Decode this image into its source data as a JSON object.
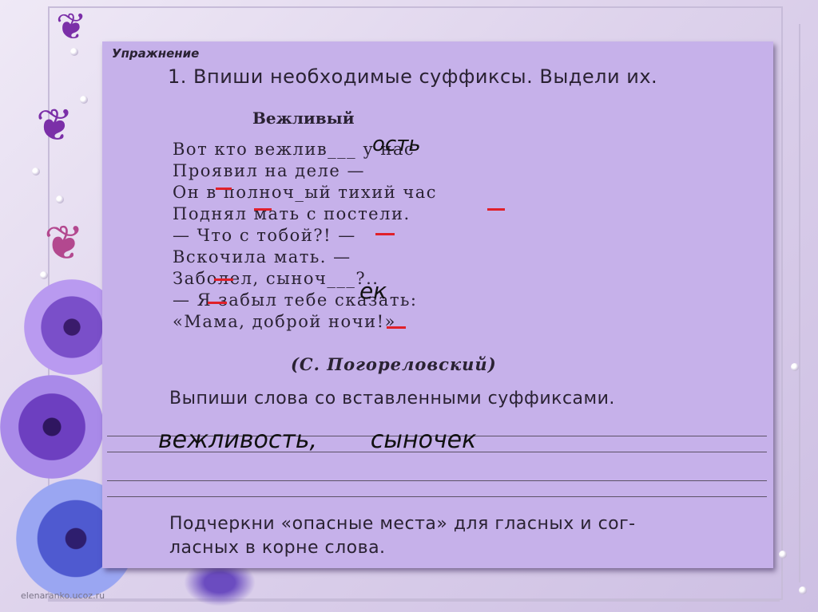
{
  "worksheet": {
    "exercise_label": "Упражнение",
    "task_number": "1.",
    "task_text": "Впиши необходимые суффиксы. Выдели их.",
    "poem_title": "Вежливый",
    "poem_lines": [
      "Вот кто вежлив___ у нас",
      "Проявил на деле —",
      "Он в полноч_ый тихий час",
      "Поднял мать с постели.",
      "— Что с тобой?! —",
      "Вскочила мать. —",
      "Заболел, сыноч___?..",
      "— Я забыл тебе сказать:",
      "«Мама, доброй ночи!»"
    ],
    "author": "(С. Погореловский)",
    "task2_text": "Выпиши слова со вставленными суффиксами.",
    "task3_line1": "Подчеркни «опасные места» для гласных и сог-",
    "task3_line2": "ласных в корне слова."
  },
  "handwriting": {
    "suffix_1": "ость",
    "suffix_2": "ек",
    "written_words": "вежливость,       сыночек"
  },
  "watermark": "elenaranko.ucoz.ru",
  "colors": {
    "panel": "#c6b1ea",
    "underline_marks": "#e0202a",
    "text": "#2a2233"
  }
}
